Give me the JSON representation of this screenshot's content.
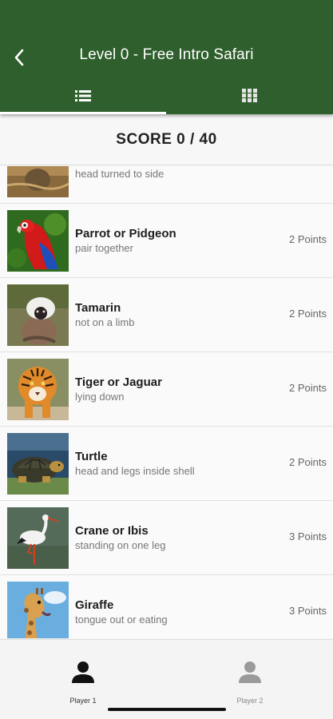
{
  "header": {
    "title": "Level 0 - Free Intro Safari",
    "tabs": [
      {
        "icon": "list-icon"
      },
      {
        "icon": "grid-icon"
      }
    ]
  },
  "score": {
    "label": "SCORE 0 / 40"
  },
  "list": {
    "partial_item": {
      "detail": "head turned to side"
    },
    "items": [
      {
        "name": "Parrot or Pidgeon",
        "detail": "pair together",
        "points": "2 Points"
      },
      {
        "name": "Tamarin",
        "detail": "not on a limb",
        "points": "2 Points"
      },
      {
        "name": "Tiger or Jaguar",
        "detail": "lying down",
        "points": "2 Points"
      },
      {
        "name": "Turtle",
        "detail": "head and legs inside shell",
        "points": "2 Points"
      },
      {
        "name": "Crane or Ibis",
        "detail": "standing on one leg",
        "points": "3 Points"
      },
      {
        "name": "Giraffe",
        "detail": "tongue out or eating",
        "points": "3 Points"
      }
    ]
  },
  "bottom_nav": {
    "items": [
      {
        "label": "Player 1",
        "icon": "person-icon",
        "color": "#111111"
      },
      {
        "label": "Player 2",
        "icon": "person-icon",
        "color": "#9a9a9a"
      }
    ]
  },
  "colors": {
    "app_bar": "#2f5f2c",
    "text_primary": "#1e1e1e",
    "text_secondary": "#777777"
  }
}
